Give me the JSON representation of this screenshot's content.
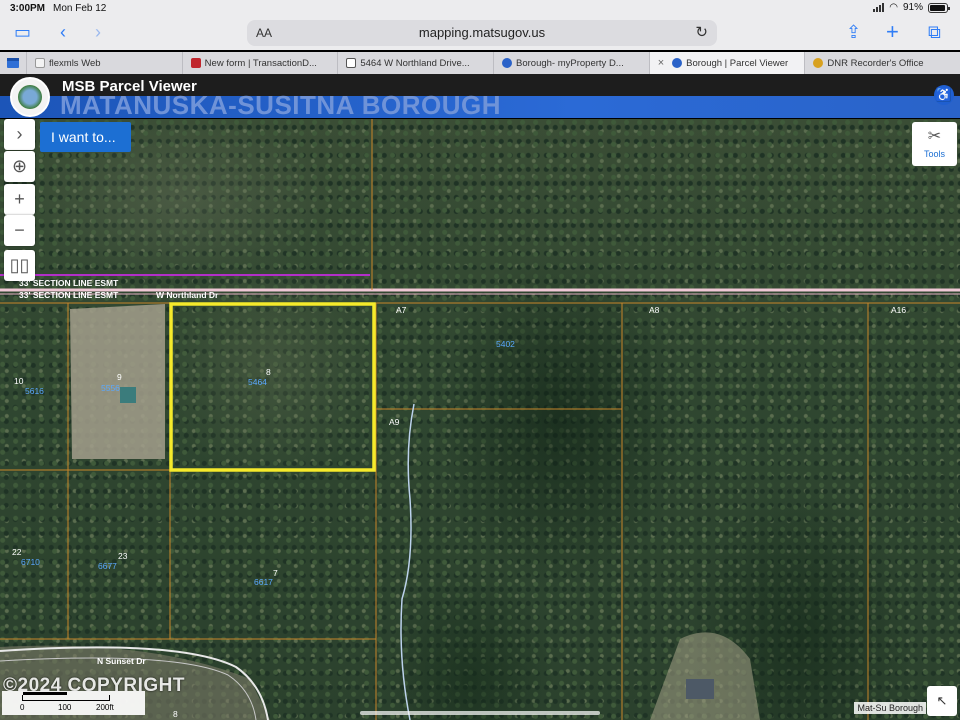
{
  "status_bar": {
    "time": "3:00PM",
    "date": "Mon Feb 12",
    "battery": "91%"
  },
  "browser": {
    "text_size_label": "AA",
    "url": "mapping.matsugov.us",
    "tabs": [
      {
        "label": "flexmls Web",
        "icon": "flexmls-favicon",
        "active": false
      },
      {
        "label": "New form | TransactionD...",
        "icon": "transactiondesk-favicon",
        "active": false
      },
      {
        "label": "5464 W Northland Drive...",
        "icon": "page-favicon",
        "active": false
      },
      {
        "label": "Borough- myProperty D...",
        "icon": "msb-favicon",
        "active": false
      },
      {
        "label": "Borough | Parcel Viewer",
        "icon": "msb-favicon",
        "active": true,
        "close": "×"
      },
      {
        "label": "DNR Recorder's Office",
        "icon": "dnr-favicon",
        "active": false
      }
    ]
  },
  "app_header": {
    "title": "MSB Parcel Viewer",
    "org": "MATANUSKA-SUSITNA BOROUGH"
  },
  "map": {
    "i_want_to_label": "I want to...",
    "tools_label": "Tools",
    "highlight_color": "#f5ea2b",
    "parcel_line_color": "#c8862a",
    "section_line_labels": [
      "33' SECTION LINE ESMT",
      "33' SECTION LINE ESMT"
    ],
    "roads": [
      "W Northland Dr",
      "N Sunset Dr"
    ],
    "parcels": [
      {
        "lot": "8",
        "address": "5464",
        "selected": true
      },
      {
        "lot": "9",
        "address": "5556"
      },
      {
        "lot": "10",
        "address": "5616"
      },
      {
        "lot": "A7",
        "address": ""
      },
      {
        "lot": "A8",
        "address": ""
      },
      {
        "lot": "A16",
        "address": ""
      },
      {
        "lot": "",
        "address": "5402"
      },
      {
        "lot": "A9",
        "address": ""
      },
      {
        "lot": "22",
        "address": "6710"
      },
      {
        "lot": "23",
        "address": "6677"
      },
      {
        "lot": "7",
        "address": "6617"
      },
      {
        "lot": "8",
        "address": ""
      }
    ],
    "copyright": "©2024 COPYRIGHT",
    "scale_ticks": [
      "0",
      "100",
      "200ft"
    ],
    "attribution": "Mat-Su Borough"
  }
}
